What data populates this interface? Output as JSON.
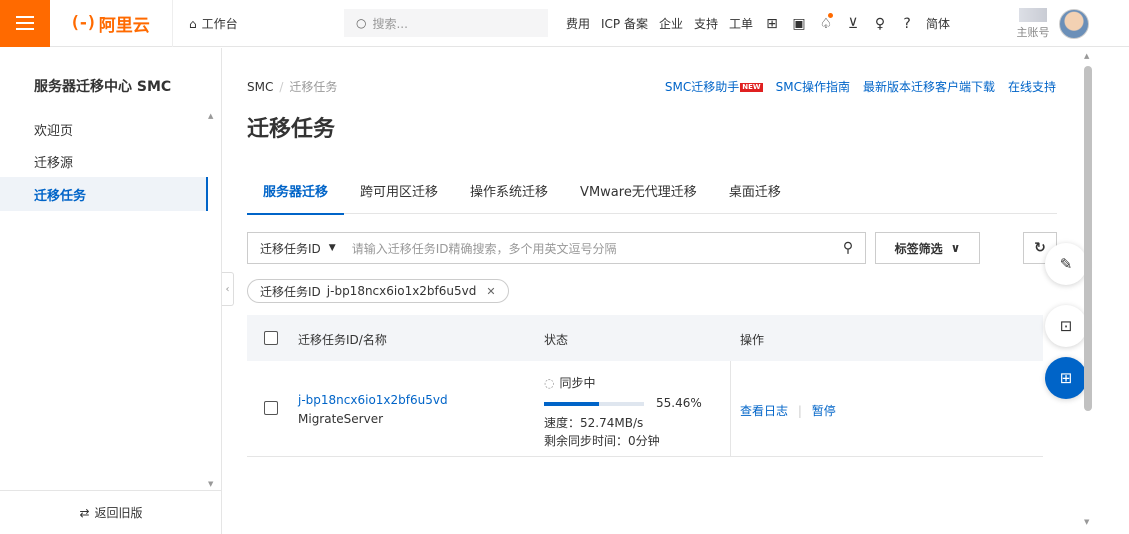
{
  "topbar": {
    "logo_text": "阿里云",
    "logo_mark": "(-)",
    "workbench_label": "工作台",
    "search_placeholder": "搜索...",
    "links": [
      "费用",
      "ICP 备案",
      "企业",
      "支持",
      "工单"
    ],
    "lang_label": "简体",
    "account_label": "主账号",
    "icons": [
      "cloudshell-icon",
      "terminal-icon",
      "bell-icon",
      "cart-icon",
      "bulb-icon",
      "help-icon"
    ]
  },
  "sidebar": {
    "title": "服务器迁移中心 SMC",
    "items": [
      {
        "label": "欢迎页"
      },
      {
        "label": "迁移源"
      },
      {
        "label": "迁移任务"
      }
    ],
    "back_label": "返回旧版"
  },
  "header": {
    "breadcrumb_root": "SMC",
    "breadcrumb_current": "迁移任务",
    "links": [
      "SMC迁移助手",
      "SMC操作指南",
      "最新版本迁移客户端下载",
      "在线支持"
    ],
    "new_badge": "NEW",
    "page_title": "迁移任务"
  },
  "tabs": [
    "服务器迁移",
    "跨可用区迁移",
    "操作系统迁移",
    "VMware无代理迁移",
    "桌面迁移"
  ],
  "filter": {
    "key_label": "迁移任务ID",
    "placeholder": "请输入迁移任务ID精确搜索，多个用英文逗号分隔",
    "tag_filter_label": "标签筛选",
    "chip_key": "迁移任务ID",
    "chip_value": "j-bp18ncx6io1x2bf6u5vd"
  },
  "table": {
    "headers": {
      "id_name": "迁移任务ID/名称",
      "status": "状态",
      "actions": "操作"
    },
    "rows": [
      {
        "id": "j-bp18ncx6io1x2bf6u5vd",
        "name": "MigrateServer",
        "status": "同步中",
        "progress_percent": 55.46,
        "progress_text": "55.46%",
        "speed": "速度：52.74MB/s",
        "remaining": "剩余同步时间：0分钟",
        "action_log": "查看日志",
        "action_pause": "暂停"
      }
    ]
  },
  "colors": {
    "brand": "#ff6a00",
    "primary": "#0064c8",
    "new_badge": "#e02020"
  }
}
